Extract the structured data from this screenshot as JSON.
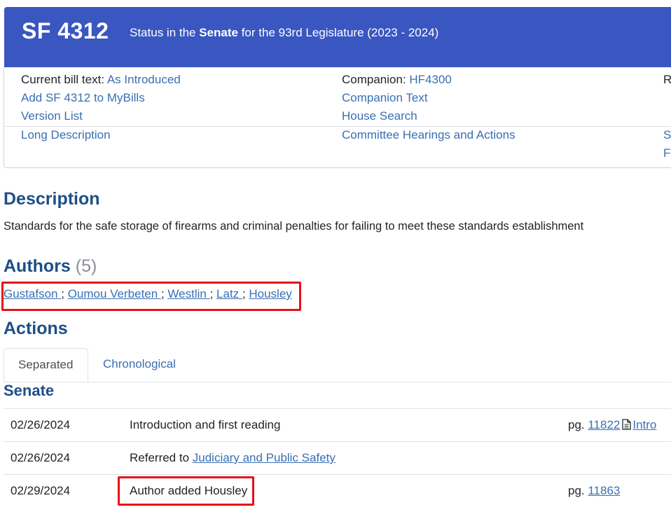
{
  "header": {
    "bill_number": "SF 4312",
    "status_prefix": "Status in the ",
    "status_body": "Senate",
    "status_suffix": " for the 93rd Legislature (2023 - 2024)"
  },
  "info": {
    "col1": {
      "current_text_label": "Current bill text: ",
      "current_text_link": "As Introduced",
      "add_mybills": "Add SF 4312 to MyBills",
      "version_list": "Version List",
      "long_description": "Long Description"
    },
    "col2": {
      "companion_label": "Companion: ",
      "companion_link": "HF4300",
      "companion_text": "Companion Text",
      "house_search": "House Search",
      "committee_hearings": "Committee Hearings and Actions"
    },
    "col3": {
      "label_partial": "R",
      "link1_partial": "S",
      "link2_partial": "F"
    }
  },
  "description": {
    "heading": "Description",
    "text": "Standards for the safe storage of firearms and criminal penalties for failing to meet these standards establishment"
  },
  "authors": {
    "heading": "Authors",
    "count": "(5)",
    "list": [
      "Gustafson ",
      "Oumou Verbeten ",
      "Westlin ",
      "Latz ",
      "Housley"
    ],
    "separator": ";"
  },
  "actions": {
    "heading": "Actions",
    "tabs": [
      "Separated",
      "Chronological"
    ],
    "chamber": "Senate",
    "rows": [
      {
        "date": "02/26/2024",
        "action": "Introduction and first reading",
        "action_link": "",
        "pg_label": "pg. ",
        "pg": "11822",
        "doc_link": "Intro"
      },
      {
        "date": "02/26/2024",
        "action": "Referred to ",
        "action_link": "Judiciary and Public Safety",
        "pg_label": "",
        "pg": "",
        "doc_link": ""
      },
      {
        "date": "02/29/2024",
        "action": "Author added Housley",
        "action_link": "",
        "pg_label": "pg. ",
        "pg": "11863",
        "doc_link": ""
      }
    ]
  },
  "colors": {
    "header_bg": "#3a56c0",
    "link": "#3a6fb2",
    "heading": "#1d4f86",
    "highlight": "#e8101a"
  }
}
